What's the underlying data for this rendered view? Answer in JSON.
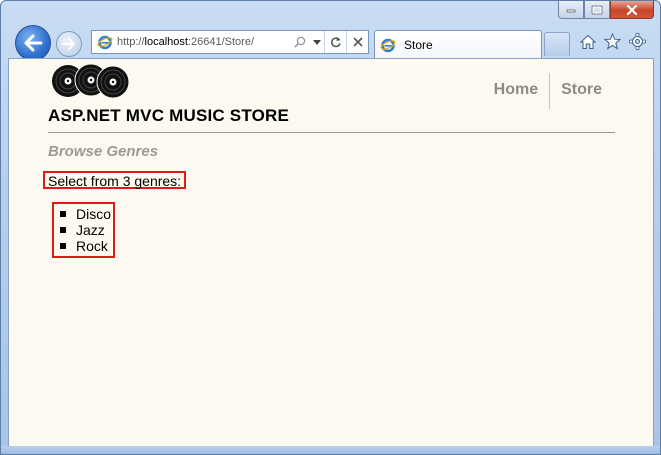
{
  "browser": {
    "address": {
      "scheme": "http://",
      "host": "localhost",
      "rest": ":26641/Store/"
    },
    "tab_title": "Store",
    "caption": {
      "minimize": "minimize",
      "maximize": "maximize",
      "close": "close"
    },
    "toolbar_icons": [
      "home-icon",
      "favorites-star-icon",
      "tools-gear-icon"
    ]
  },
  "site": {
    "title": "ASP.NET MVC MUSIC STORE",
    "nav": [
      {
        "label": "Home"
      },
      {
        "label": "Store"
      }
    ]
  },
  "main": {
    "heading": "Browse Genres",
    "genre_count_text": "Select from 3 genres:",
    "genres": [
      {
        "name": "Disco"
      },
      {
        "name": "Jazz"
      },
      {
        "name": "Rock"
      }
    ]
  },
  "colors": {
    "page_background": "#fcfaf0",
    "nav_link": "#8a8a86",
    "heading": "#9d9a96",
    "highlight_box": "#e01a1a"
  }
}
